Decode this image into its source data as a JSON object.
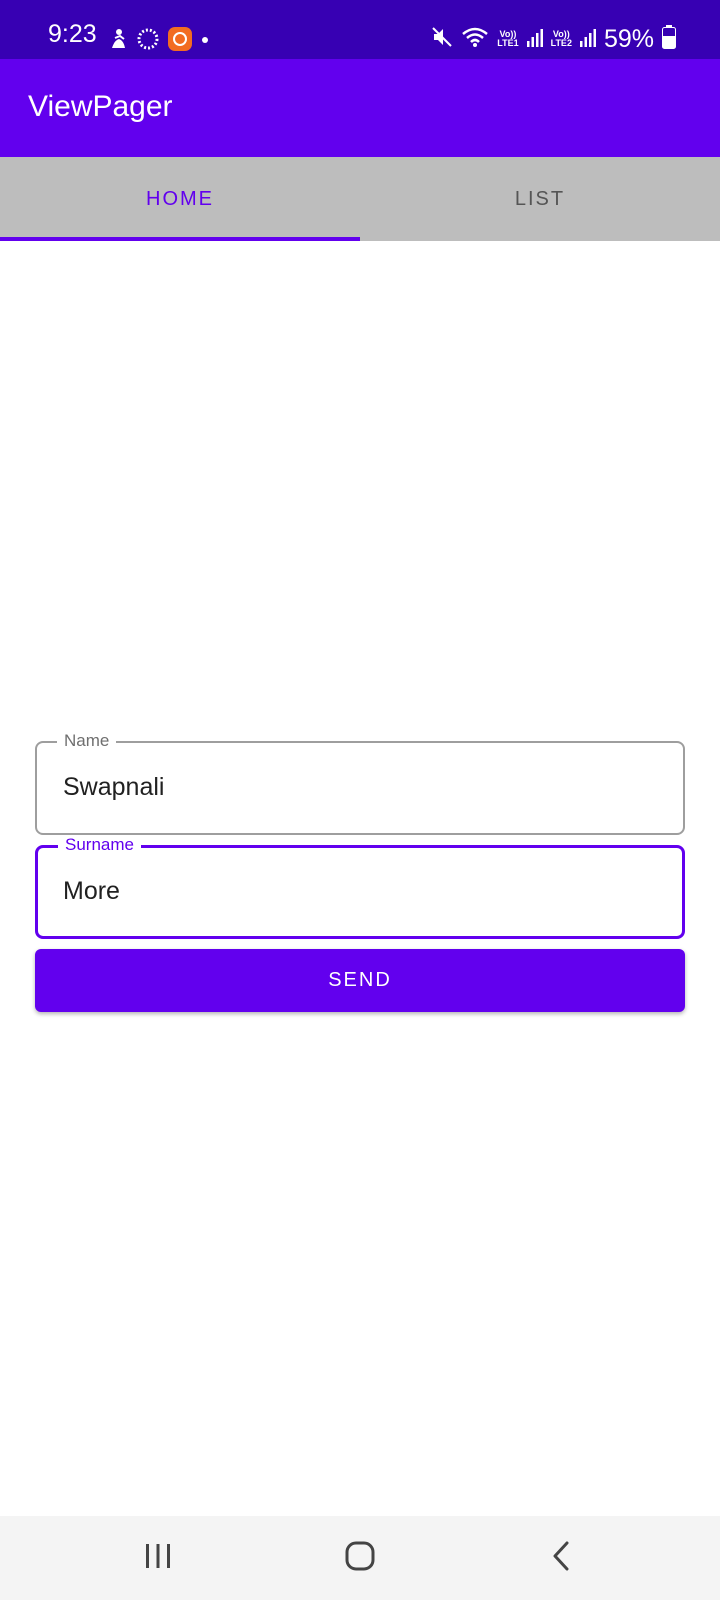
{
  "status_bar": {
    "time": "9:23",
    "battery_percent": "59%",
    "battery_level": 0.59,
    "sim1_label_top": "Vo))",
    "sim1_label_bottom": "LTE1",
    "sim2_label_top": "Vo))",
    "sim2_label_bottom": "LTE2",
    "left_icons": [
      "person-walk-icon",
      "circle-progress-icon",
      "orange-app-icon",
      "dot-icon"
    ],
    "right_icons": [
      "mute-icon",
      "wifi-icon",
      "signal-bars-icon",
      "signal-bars-icon",
      "battery-icon"
    ]
  },
  "app_bar": {
    "title": "ViewPager",
    "color": "#6200EE"
  },
  "tabs": [
    {
      "label": "HOME",
      "selected": true
    },
    {
      "label": "LIST",
      "selected": false
    }
  ],
  "form": {
    "name": {
      "label": "Name",
      "value": "Swapnali"
    },
    "surname": {
      "label": "Surname",
      "value": "More",
      "focused": true
    },
    "send_label": "SEND"
  },
  "nav_bar": {
    "icons": [
      "recent-apps-icon",
      "home-icon",
      "back-icon"
    ]
  },
  "colors": {
    "primary": "#6200EE",
    "primary_dark": "#3700B3",
    "tab_bg": "#BDBDBD"
  }
}
